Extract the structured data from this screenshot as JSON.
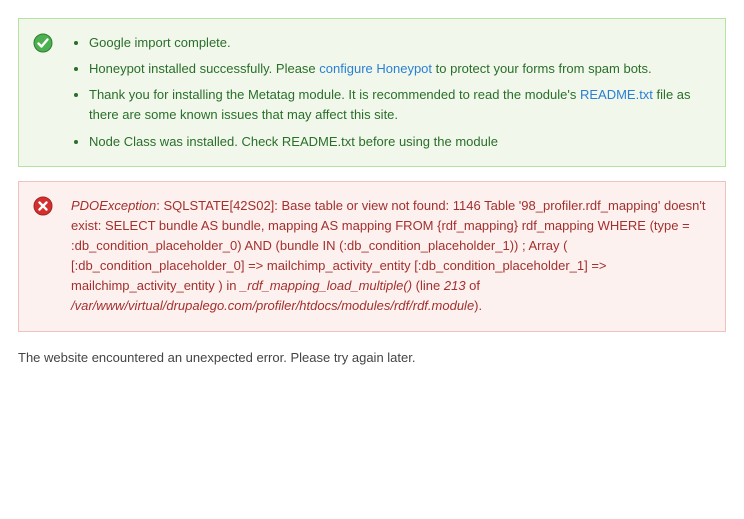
{
  "status": {
    "items": [
      {
        "text": "Google import complete."
      },
      {
        "prefix": "Honeypot installed successfully. Please ",
        "link": "configure Honeypot",
        "suffix": " to protect your forms from spam bots."
      },
      {
        "prefix": "Thank you for installing the Metatag module. It is recommended to read the module's ",
        "link": "README.txt",
        "suffix": " file as there are some known issues that may affect this site."
      },
      {
        "text": "Node Class was installed. Check README.txt before using the module"
      }
    ]
  },
  "error": {
    "em1": "PDOException",
    "text1": ": SQLSTATE[42S02]: Base table or view not found: 1146 Table '98_profiler.rdf_mapping' doesn't exist: SELECT bundle AS bundle, mapping AS mapping FROM {rdf_mapping} rdf_mapping WHERE (type = :db_condition_placeholder_0) AND (bundle IN (:db_condition_placeholder_1)) ; Array ( [:db_condition_placeholder_0] => mailchimp_activity_entity [:db_condition_placeholder_1] => mailchimp_activity_entity ) in ",
    "em2": "_rdf_mapping_load_multiple()",
    "text2": " (line ",
    "em3": "213",
    "text3": " of ",
    "em4": "/var/www/virtual/drupalego.com/profiler/htdocs/modules/rdf/rdf.module",
    "text4": ")."
  },
  "page_message": "The website encountered an unexpected error. Please try again later."
}
